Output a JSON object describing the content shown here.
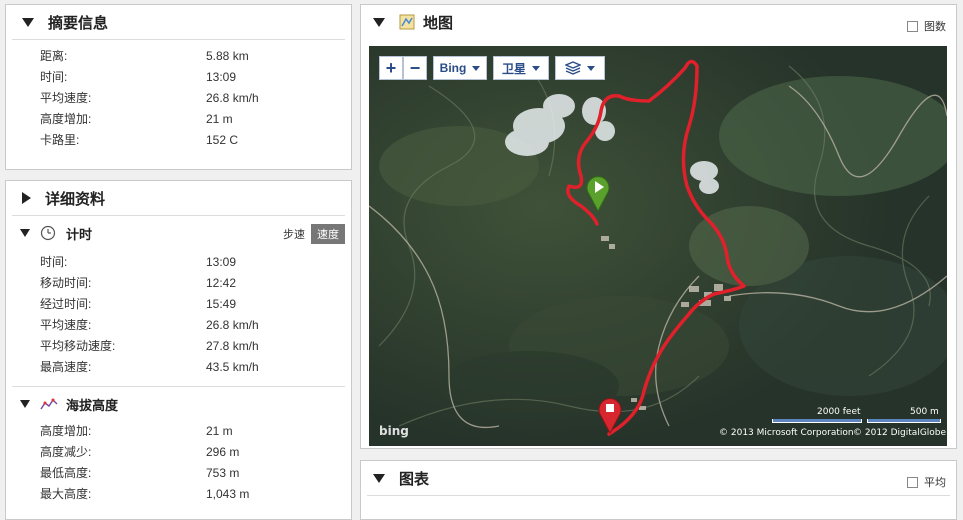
{
  "summary": {
    "title": "摘要信息",
    "rows": [
      {
        "label": "距离:",
        "value": "5.88 km"
      },
      {
        "label": "时间:",
        "value": "13:09"
      },
      {
        "label": "平均速度:",
        "value": "26.8 km/h"
      },
      {
        "label": "高度增加:",
        "value": "21 m"
      },
      {
        "label": "卡路里:",
        "value": "152 C"
      }
    ]
  },
  "details": {
    "title": "详细资料",
    "timing": {
      "title": "计时",
      "pace_label": "步速",
      "speed_label": "速度",
      "rows": [
        {
          "label": "时间:",
          "value": "13:09"
        },
        {
          "label": "移动时间:",
          "value": "12:42"
        },
        {
          "label": "经过时间:",
          "value": "15:49"
        },
        {
          "label": "平均速度:",
          "value": "26.8 km/h"
        },
        {
          "label": "平均移动速度:",
          "value": "27.8 km/h"
        },
        {
          "label": "最高速度:",
          "value": "43.5 km/h"
        }
      ]
    },
    "elevation": {
      "title": "海拔高度",
      "rows": [
        {
          "label": "高度增加:",
          "value": "21 m"
        },
        {
          "label": "高度减少:",
          "value": "296 m"
        },
        {
          "label": "最低高度:",
          "value": "753 m"
        },
        {
          "label": "最大高度:",
          "value": "1,043 m"
        }
      ]
    }
  },
  "map_panel": {
    "title": "地图",
    "legend_label": "图数",
    "zoom_in": "+",
    "zoom_out": "−",
    "provider": "Bing",
    "map_type": "卫星",
    "scale_feet": "2000 feet",
    "scale_m": "500 m",
    "copyright_ms": "© 2013 Microsoft Corporation",
    "copyright_dg": "© 2012 DigitalGlobe",
    "bing_logo": "bing"
  },
  "chart_panel": {
    "title": "图表",
    "average_label": "平均"
  },
  "colors": {
    "route": "#e0202a",
    "start_marker": "#5aa02c",
    "end_marker": "#d8262e",
    "map_ctrl_text": "#2a4d8a"
  }
}
